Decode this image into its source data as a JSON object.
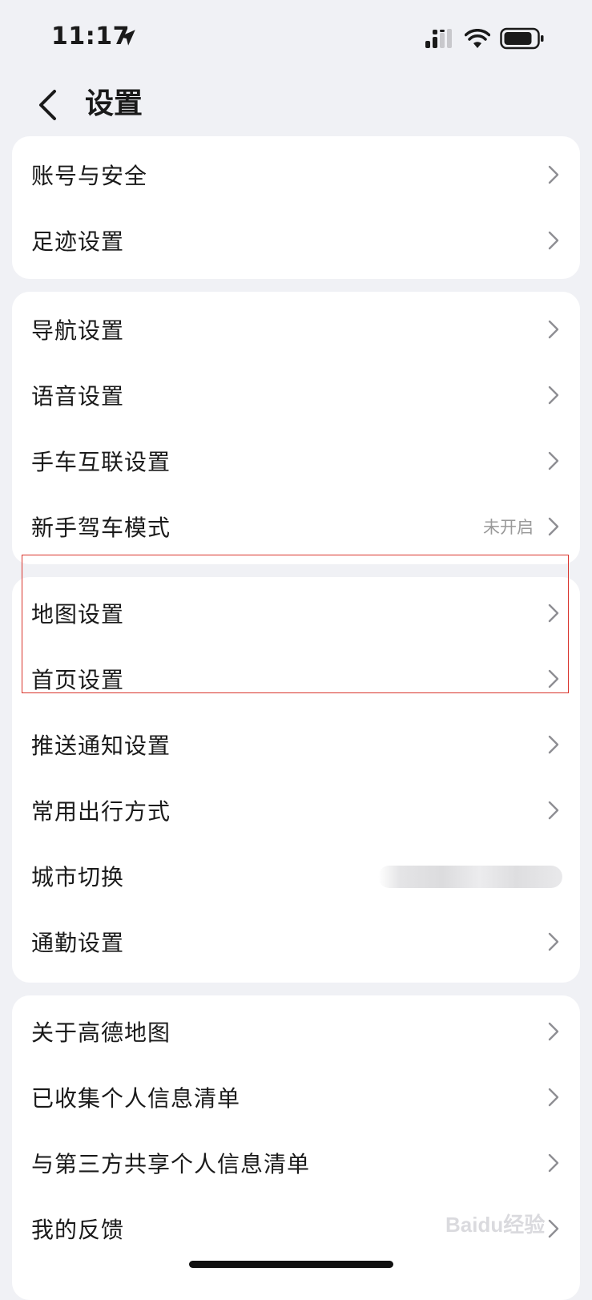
{
  "status_bar": {
    "time": "11:17"
  },
  "header": {
    "title": "设置"
  },
  "groups": [
    {
      "items": [
        {
          "label": "账号与安全"
        },
        {
          "label": "足迹设置"
        }
      ]
    },
    {
      "items": [
        {
          "label": "导航设置"
        },
        {
          "label": "语音设置"
        },
        {
          "label": "手车互联设置"
        },
        {
          "label": "新手驾车模式",
          "value": "未开启"
        }
      ]
    },
    {
      "items": [
        {
          "label": "地图设置"
        },
        {
          "label": "首页设置"
        },
        {
          "label": "推送通知设置"
        },
        {
          "label": "常用出行方式"
        },
        {
          "label": "城市切换"
        },
        {
          "label": "通勤设置"
        }
      ]
    },
    {
      "items": [
        {
          "label": "关于高德地图"
        },
        {
          "label": "已收集个人信息清单"
        },
        {
          "label": "与第三方共享个人信息清单"
        },
        {
          "label": "我的反馈"
        }
      ]
    }
  ],
  "colors": {
    "background": "#f0f1f5",
    "card": "#ffffff",
    "highlight": "#d9332b",
    "secondary_text": "#9a9a9a"
  },
  "watermark": "Baidu经验"
}
